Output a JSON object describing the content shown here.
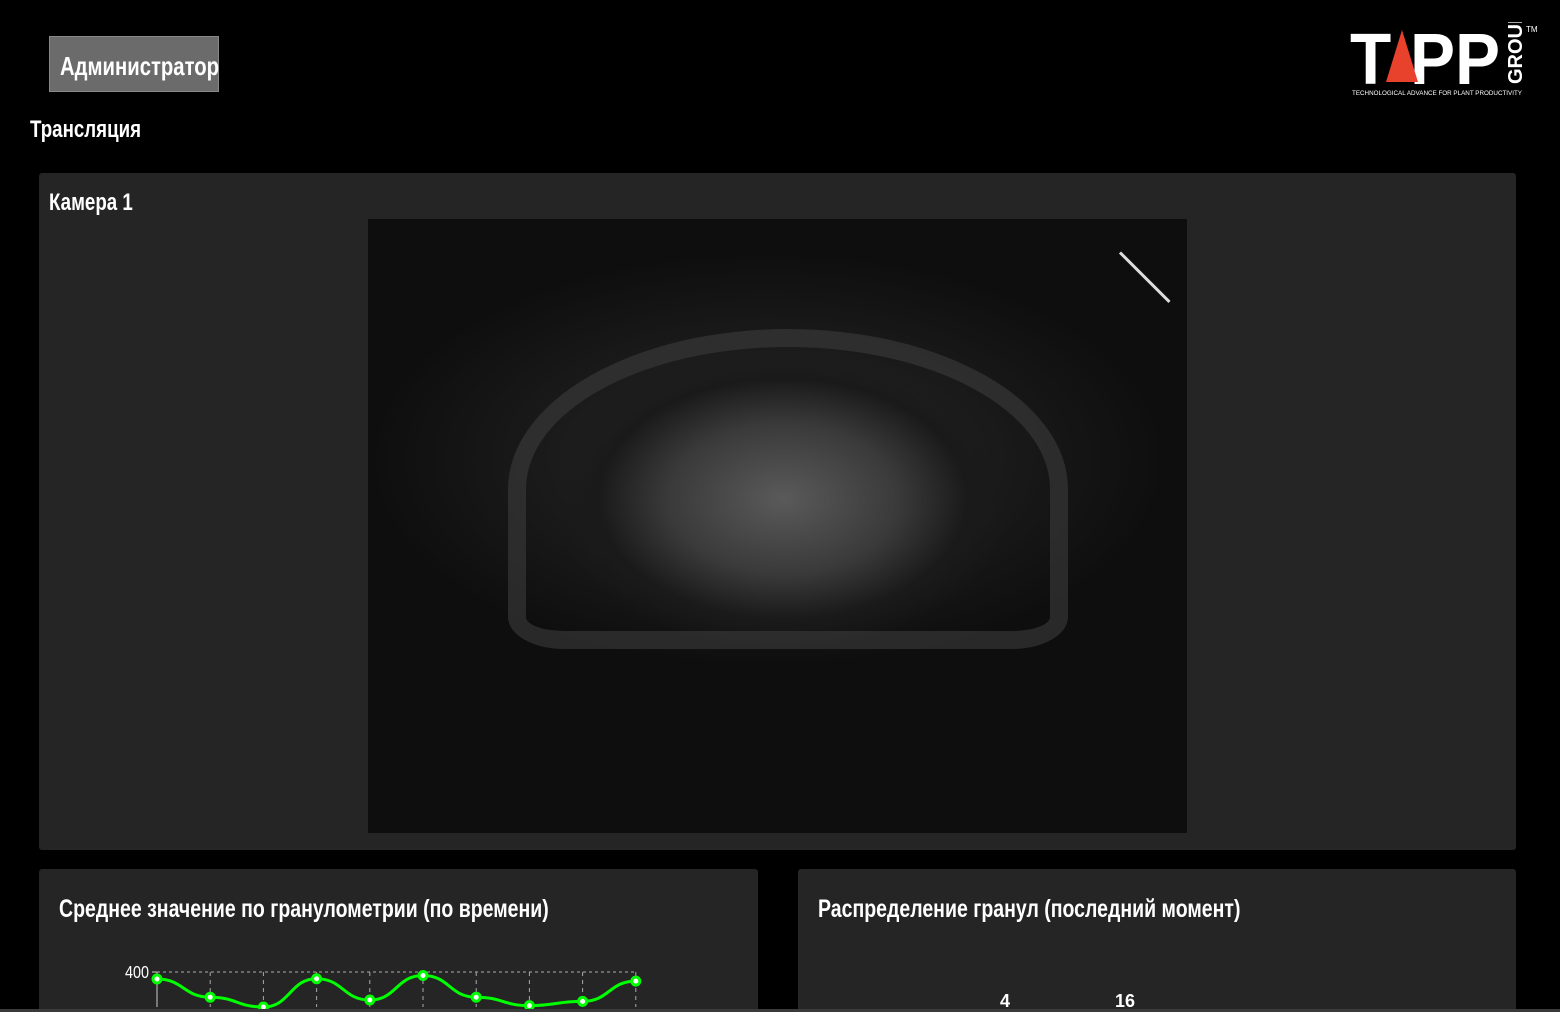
{
  "header": {
    "admin_button": "Администратор",
    "section_title": "Трансляция",
    "logo": {
      "text": "TAPP",
      "group": "GROUP",
      "tm": "TM",
      "tagline": "TECHNOLOGICAL ADVANCE FOR PLANT PRODUCTIVITY",
      "accent": "#e8412c"
    }
  },
  "camera": {
    "title": "Камера 1"
  },
  "charts": [
    {
      "title": "Среднее значение по гранулометрии (по времени)"
    },
    {
      "title": "Распределение гранул (последний момент)"
    }
  ],
  "chart_data": [
    {
      "type": "line",
      "title": "Среднее значение по гранулометрии (по времени)",
      "y_ticks": [
        "400"
      ],
      "ylim": [
        0,
        400
      ],
      "color": "#00ff00",
      "grid": true,
      "values": [
        350,
        220,
        150,
        352,
        200,
        375,
        220,
        160,
        190,
        335
      ]
    },
    {
      "type": "bar",
      "title": "Распределение гранул (последний момент)",
      "data_labels": [
        "4",
        "16"
      ]
    }
  ]
}
